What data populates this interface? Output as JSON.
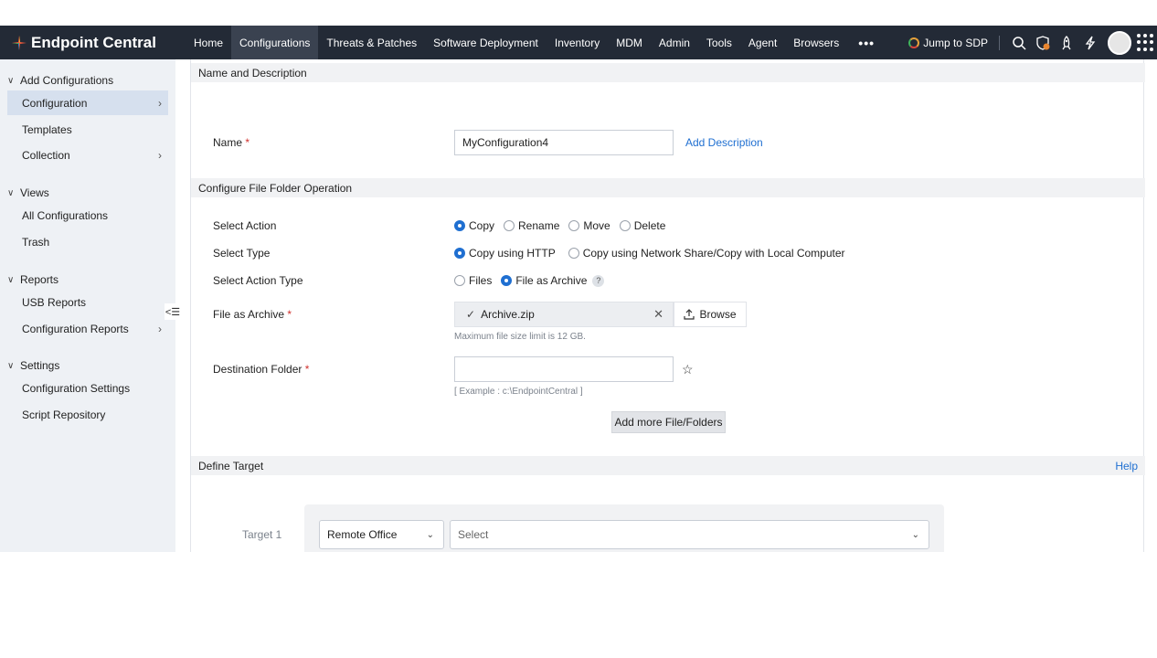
{
  "brand": {
    "name": "Endpoint Central"
  },
  "nav": {
    "items": [
      "Home",
      "Configurations",
      "Threats & Patches",
      "Software Deployment",
      "Inventory",
      "MDM",
      "Admin",
      "Tools",
      "Agent",
      "Browsers"
    ],
    "active": "Configurations",
    "more": "•••"
  },
  "topright": {
    "jump_sdp": "Jump to SDP"
  },
  "sidebar": {
    "groups": [
      {
        "label": "Add Configurations",
        "items": [
          "Configuration",
          "Templates",
          "Collection"
        ]
      },
      {
        "label": "Views",
        "items": [
          "All Configurations",
          "Trash"
        ]
      },
      {
        "label": "Reports",
        "items": [
          "USB Reports",
          "Configuration Reports"
        ]
      },
      {
        "label": "Settings",
        "items": [
          "Configuration Settings",
          "Script Repository"
        ]
      }
    ],
    "active_item": "Configuration",
    "collapse_icon": "<☰"
  },
  "sections": {
    "name_desc": "Name and Description",
    "file_folder": "Configure File Folder Operation",
    "define_target": "Define Target"
  },
  "help": "Help",
  "name_field": {
    "label": "Name",
    "value": "MyConfiguration4",
    "add_description": "Add Description"
  },
  "select_action": {
    "label": "Select Action",
    "options": [
      "Copy",
      "Rename",
      "Move",
      "Delete"
    ],
    "selected": "Copy"
  },
  "select_type": {
    "label": "Select Type",
    "options": [
      "Copy using HTTP",
      "Copy using Network Share/Copy with Local Computer"
    ],
    "selected": "Copy using HTTP"
  },
  "select_action_type": {
    "label": "Select Action Type",
    "options": [
      "Files",
      "File as Archive"
    ],
    "selected": "File as Archive",
    "help": "?"
  },
  "file_archive": {
    "label": "File as Archive",
    "file_name": "Archive.zip",
    "browse": "Browse",
    "hint": "Maximum file size limit is 12 GB."
  },
  "destination": {
    "label": "Destination Folder",
    "value": "",
    "hint": "[ Example : c:\\EndpointCentral ]"
  },
  "add_more": "Add more File/Folders",
  "target": {
    "label": "Target 1",
    "type": "Remote Office",
    "select_placeholder": "Select"
  },
  "colors": {
    "topbar": "#232a36",
    "accent": "#1f6fd1",
    "required": "#d0312d"
  }
}
